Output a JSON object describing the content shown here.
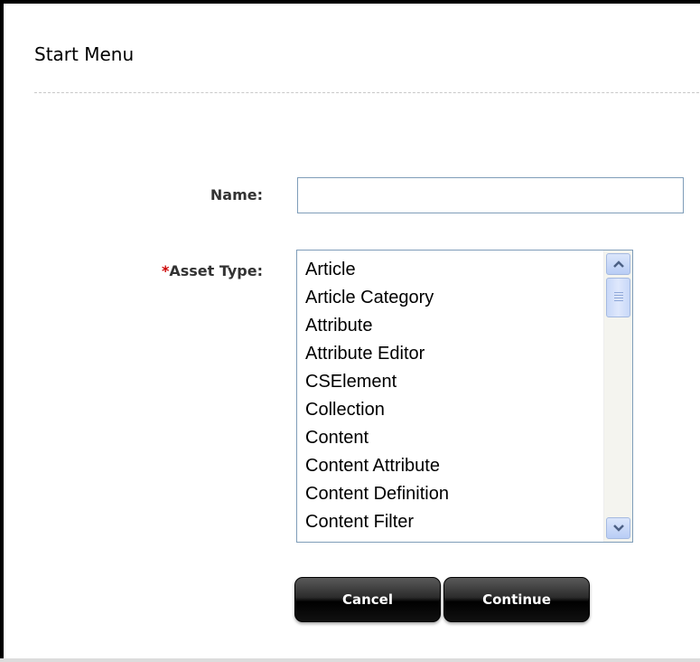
{
  "dialog": {
    "title": "Start Menu"
  },
  "form": {
    "name": {
      "label": "Name:",
      "value": "",
      "placeholder": ""
    },
    "asset_type": {
      "required_marker": "*",
      "label": "Asset Type:",
      "options": [
        "Article",
        "Article Category",
        "Attribute",
        "Attribute Editor",
        "CSElement",
        "Collection",
        "Content",
        "Content Attribute",
        "Content Definition",
        "Content Filter"
      ]
    }
  },
  "buttons": {
    "cancel_label": "Cancel",
    "continue_label": "Continue"
  },
  "icons": {
    "scroll_up": "chevron-up-icon",
    "scroll_down": "chevron-down-icon"
  },
  "colors": {
    "required": "#cc0000",
    "input_border": "#7f9db9",
    "button_bg": "#000000"
  }
}
